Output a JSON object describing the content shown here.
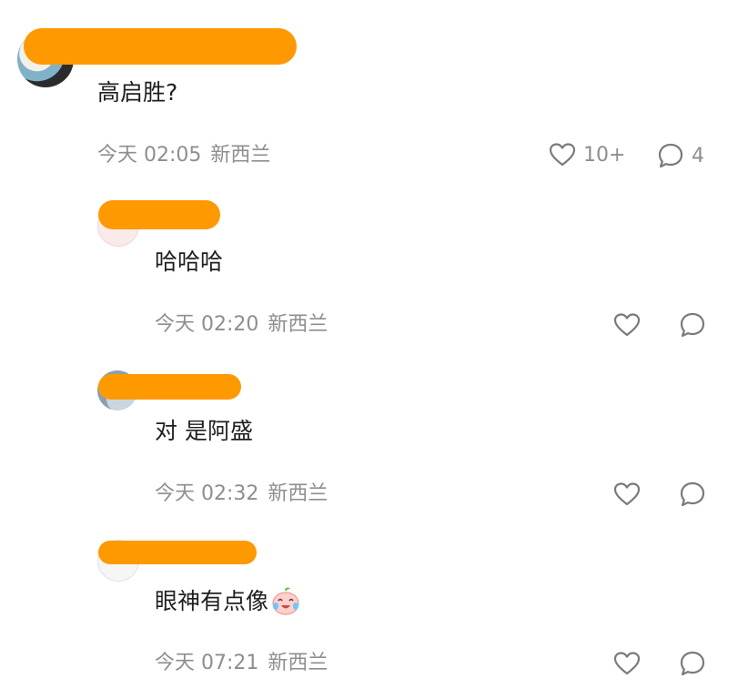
{
  "colors": {
    "redaction": "#ff9900",
    "meta_text": "#8e8e8e",
    "content_text": "#1f1f1f",
    "icon_stroke": "#7a7a7a"
  },
  "comment": {
    "text": "高启胜?",
    "time": "今天 02:05",
    "location": "新西兰",
    "like_icon": "heart-icon",
    "like_count": "10+",
    "reply_icon": "comment-bubble-icon",
    "reply_count": "4"
  },
  "replies": [
    {
      "text": "哈哈哈",
      "time": "今天 02:20",
      "location": "新西兰",
      "like_icon": "heart-icon",
      "reply_icon": "comment-bubble-icon"
    },
    {
      "text": "对 是阿盛",
      "time": "今天 02:32",
      "location": "新西兰",
      "like_icon": "heart-icon",
      "reply_icon": "comment-bubble-icon"
    },
    {
      "text": "眼神有点像",
      "emoji_icon": "crying-laughing-peach-emoji",
      "time": "今天 07:21",
      "location": "新西兰",
      "like_icon": "heart-icon",
      "reply_icon": "comment-bubble-icon"
    }
  ]
}
